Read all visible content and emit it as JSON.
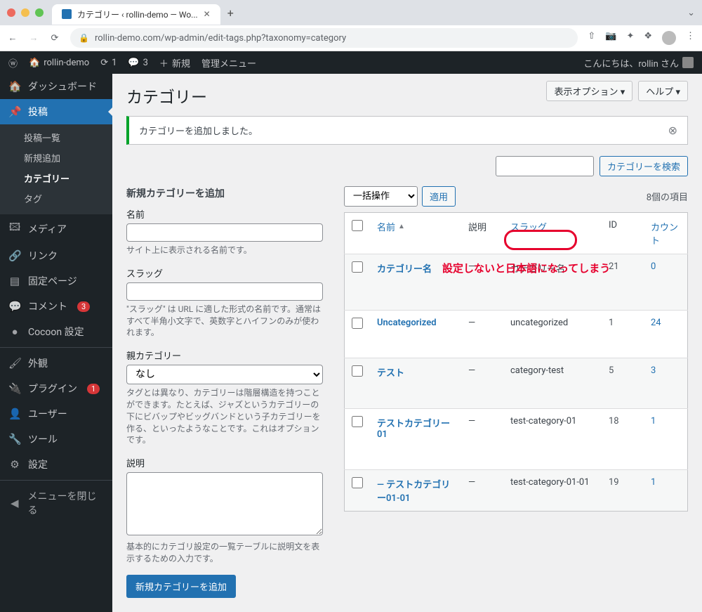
{
  "chrome": {
    "tab_title": "カテゴリー ‹ rollin-demo — Wo...",
    "url": "rollin-demo.com/wp-admin/edit-tags.php?taxonomy=category"
  },
  "adminbar": {
    "site_name": "rollin-demo",
    "updates": "1",
    "comments": "3",
    "new": "新規",
    "admin_menu": "管理メニュー",
    "greeting": "こんにちは、rollin さん"
  },
  "sidebar": {
    "dashboard": "ダッシュボード",
    "posts": "投稿",
    "posts_sub": {
      "all": "投稿一覧",
      "new": "新規追加",
      "categories": "カテゴリー",
      "tags": "タグ"
    },
    "media": "メディア",
    "links": "リンク",
    "pages": "固定ページ",
    "comments": "コメント",
    "comments_count": "3",
    "cocoon": "Cocoon 設定",
    "appearance": "外観",
    "plugins": "プラグイン",
    "plugins_count": "1",
    "users": "ユーザー",
    "tools": "ツール",
    "settings": "設定",
    "collapse": "メニューを閉じる"
  },
  "screen": {
    "options": "表示オプション ▾",
    "help": "ヘルプ ▾",
    "title": "カテゴリー",
    "notice": "カテゴリーを追加しました。"
  },
  "form": {
    "heading": "新規カテゴリーを追加",
    "name_label": "名前",
    "name_help": "サイト上に表示される名前です。",
    "slug_label": "スラッグ",
    "slug_help": "\"スラッグ\" は URL に適した形式の名前です。通常はすべて半角小文字で、英数字とハイフンのみが使われます。",
    "parent_label": "親カテゴリー",
    "parent_none": "なし",
    "parent_help": "タグとは異なり、カテゴリーは階層構造を持つことができます。たとえば、ジャズというカテゴリーの下にビバップやビッグバンドという子カテゴリーを作る、といったようなことです。これはオプションです。",
    "desc_label": "説明",
    "desc_help": "基本的にカテゴリ設定の一覧テーブルに説明文を表示するための入力です。",
    "submit": "新規カテゴリーを追加"
  },
  "table": {
    "search_btn": "カテゴリーを検索",
    "bulk_label": "一括操作",
    "apply": "適用",
    "count_text": "8個の項目",
    "cols": {
      "name": "名前",
      "desc": "説明",
      "slug": "スラッグ",
      "id": "ID",
      "posts": "カウント"
    },
    "rows": [
      {
        "name": "カテゴリー名",
        "desc": "—",
        "slug": "カテゴリー名",
        "id": "21",
        "posts": "0"
      },
      {
        "name": "Uncategorized",
        "desc": "—",
        "slug": "uncategorized",
        "id": "1",
        "posts": "24"
      },
      {
        "name": "テスト",
        "desc": "—",
        "slug": "category-test",
        "id": "5",
        "posts": "3"
      },
      {
        "name": "テストカテゴリー01",
        "desc": "—",
        "slug": "test-category-01",
        "id": "18",
        "posts": "1"
      },
      {
        "name": "— テストカテゴリー01-01",
        "desc": "—",
        "slug": "test-category-01-01",
        "id": "19",
        "posts": "1"
      }
    ]
  },
  "annotation": {
    "text": "設定しないと日本語になってしまう"
  }
}
